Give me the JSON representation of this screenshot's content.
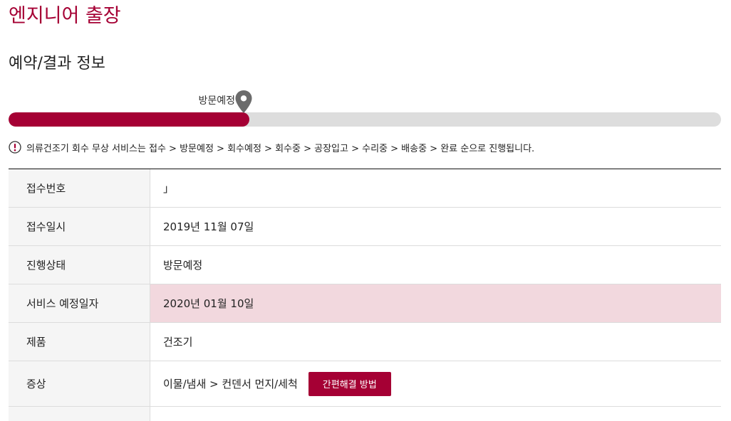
{
  "page": {
    "title": "엔지니어 출장",
    "section_title": "예약/결과 정보"
  },
  "progress": {
    "label": "방문예정",
    "value_fraction": 0.338,
    "icon": "location-pin-icon"
  },
  "notice": {
    "icon": "exclamation-icon",
    "text": "의류건조기 회수 무상 서비스는 접수 > 방문예정 > 회수예정 > 회수중 > 공장입고 > 수리중 > 배송중 > 완료 순으로 진행됩니다."
  },
  "table": {
    "rows": [
      {
        "label": "접수번호",
        "value": "」"
      },
      {
        "label": "접수일시",
        "value": "2019년 11월 07일"
      },
      {
        "label": "진행상태",
        "value": "방문예정"
      },
      {
        "label": "서비스 예정일자",
        "value": "2020년 01월 10일"
      },
      {
        "label": "제품",
        "value": "건조기"
      },
      {
        "label": "증상",
        "value": "이물/냄새 > 컨덴서 먼지/세척",
        "button_label": "간편해결 방법"
      }
    ]
  },
  "colors": {
    "accent": "#a50034",
    "title": "#a50034",
    "highlight_row": "#f2d8de",
    "track": "#dddddd",
    "marker": "#6b6b6b"
  }
}
